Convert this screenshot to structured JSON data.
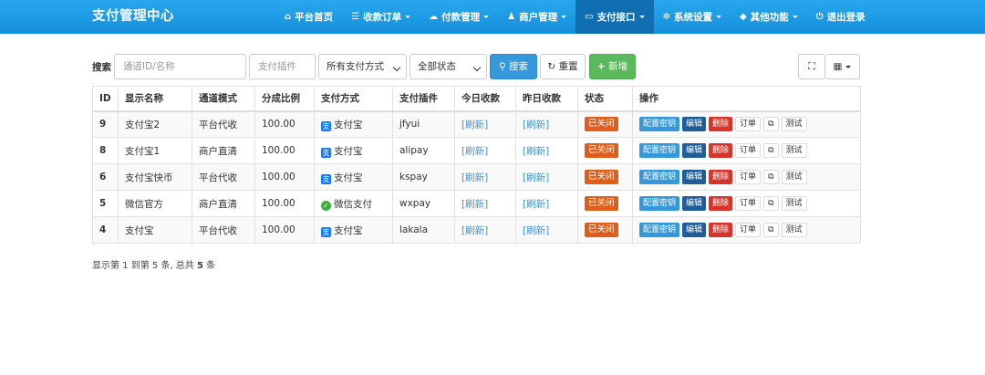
{
  "navbar": {
    "brand": "支付管理中心",
    "items": [
      {
        "icon": "⌂",
        "label": "平台首页",
        "dropdown": false,
        "active": false
      },
      {
        "icon": "☰",
        "label": "收款订单",
        "dropdown": true,
        "active": false
      },
      {
        "icon": "☁",
        "label": "付款管理",
        "dropdown": true,
        "active": false
      },
      {
        "icon": "♟",
        "label": "商户管理",
        "dropdown": true,
        "active": false
      },
      {
        "icon": "▭",
        "label": "支付接口",
        "dropdown": true,
        "active": true
      },
      {
        "icon": "✲",
        "label": "系统设置",
        "dropdown": true,
        "active": false
      },
      {
        "icon": "◆",
        "label": "其他功能",
        "dropdown": true,
        "active": false
      },
      {
        "icon": "⏻",
        "label": "退出登录",
        "dropdown": false,
        "active": false
      }
    ]
  },
  "toolbar": {
    "search_label": "搜索",
    "channel_placeholder": "通道ID/名称",
    "plugin_placeholder": "支付插件",
    "paytype_select": "所有支付方式",
    "status_select": "全部状态",
    "search_button": "搜索",
    "reset_button": "重置",
    "add_button": "新增",
    "fullscreen_icon": "⛶",
    "columns_icon": "▦"
  },
  "table": {
    "headers": [
      "ID",
      "显示名称",
      "通道模式",
      "分成比例",
      "支付方式",
      "支付插件",
      "今日收款",
      "昨日收款",
      "状态",
      "操作"
    ],
    "rows": [
      {
        "id": "9",
        "name": "支付宝2",
        "mode": "平台代收",
        "ratio": "100.00",
        "paytype": "支付宝",
        "paytype_icon": "alipay",
        "plugin": "jfyui",
        "today": "[刷新]",
        "yesterday": "[刷新]",
        "status": "已关闭"
      },
      {
        "id": "8",
        "name": "支付宝1",
        "mode": "商户直清",
        "ratio": "100.00",
        "paytype": "支付宝",
        "paytype_icon": "alipay",
        "plugin": "alipay",
        "today": "[刷新]",
        "yesterday": "[刷新]",
        "status": "已关闭"
      },
      {
        "id": "6",
        "name": "支付宝快币",
        "mode": "平台代收",
        "ratio": "100.00",
        "paytype": "支付宝",
        "paytype_icon": "alipay",
        "plugin": "kspay",
        "today": "[刷新]",
        "yesterday": "[刷新]",
        "status": "已关闭"
      },
      {
        "id": "5",
        "name": "微信官方",
        "mode": "商户直清",
        "ratio": "100.00",
        "paytype": "微信支付",
        "paytype_icon": "wxpay",
        "plugin": "wxpay",
        "today": "[刷新]",
        "yesterday": "[刷新]",
        "status": "已关闭"
      },
      {
        "id": "4",
        "name": "支付宝",
        "mode": "平台代收",
        "ratio": "100.00",
        "paytype": "支付宝",
        "paytype_icon": "alipay",
        "plugin": "lakala",
        "today": "[刷新]",
        "yesterday": "[刷新]",
        "status": "已关闭"
      }
    ],
    "actions": {
      "key": "配置密钥",
      "edit": "编辑",
      "delete": "删除",
      "orders": "订单",
      "copy_icon": "⧉",
      "test": "测试"
    }
  },
  "pager": {
    "prefix": "显示第 1 到第 5 条, 总共 ",
    "total": "5",
    "suffix": " 条"
  },
  "colors": {
    "navbar": "#1e9be5",
    "active_nav": "#0f6fb0",
    "primary": "#3498db",
    "success": "#5cb85c",
    "danger": "#d9342b",
    "closed_badge": "#e05d1a"
  }
}
